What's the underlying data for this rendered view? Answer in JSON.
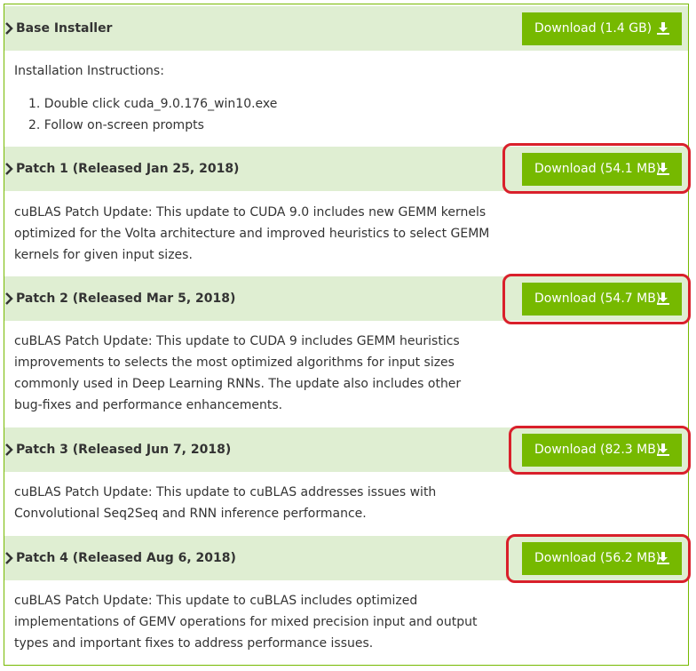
{
  "sections": [
    {
      "title": "Base Installer",
      "download_label": "Download (1.4 GB)",
      "instructions_heading": "Installation Instructions:",
      "steps": [
        "1. Double click cuda_9.0.176_win10.exe",
        "2. Follow on-screen prompts"
      ]
    },
    {
      "title": "Patch 1 (Released Jan 25, 2018)",
      "download_label": "Download (54.1 MB)",
      "lines": [
        "cuBLAS Patch Update: This update to CUDA 9.0 includes new GEMM kernels",
        "optimized for the Volta architecture and improved heuristics to select GEMM",
        "kernels for given input sizes."
      ]
    },
    {
      "title": "Patch 2 (Released Mar 5, 2018)",
      "download_label": "Download (54.7 MB)",
      "lines": [
        "cuBLAS Patch Update: This update to CUDA 9 includes GEMM heuristics",
        "improvements to selects the most optimized algorithms for input sizes",
        "commonly used in Deep Learning RNNs. The update also includes other",
        "bug-fixes and performance enhancements."
      ]
    },
    {
      "title": "Patch 3 (Released Jun 7, 2018)",
      "download_label": "Download (82.3 MB)",
      "lines": [
        "cuBLAS Patch Update: This update to cuBLAS addresses issues with",
        "Convolutional Seq2Seq and RNN inference performance."
      ]
    },
    {
      "title": "Patch 4 (Released Aug 6, 2018)",
      "download_label": "Download (56.2 MB)",
      "lines": [
        "cuBLAS Patch Update: This update to cuBLAS includes optimized",
        "implementations of GEMV operations for mixed precision input and output",
        "types and important fixes to address performance issues."
      ]
    }
  ],
  "icons": {
    "expand": "chevron-right-icon",
    "download": "download-icon"
  },
  "colors": {
    "accent": "#76b900",
    "header_bg": "#dfeed2",
    "highlight_ring": "#d9202b"
  }
}
